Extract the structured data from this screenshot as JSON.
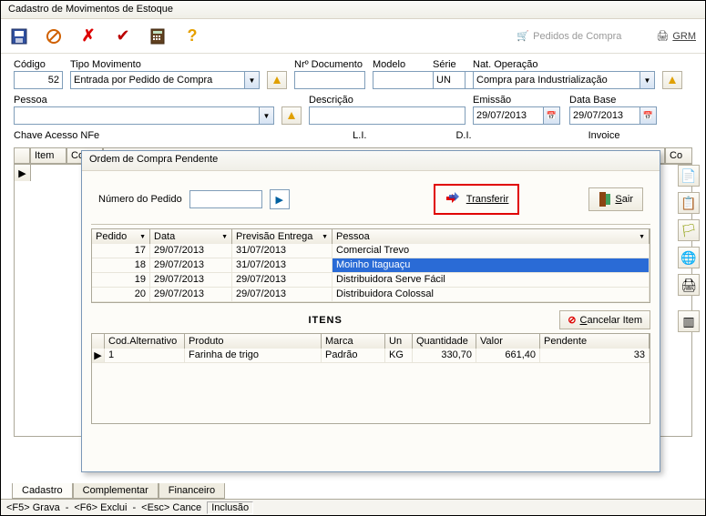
{
  "window": {
    "title": "Cadastro de Movimentos de Estoque"
  },
  "toolbar": {
    "pedidos_compra": "Pedidos de Compra",
    "grm": "GRM"
  },
  "fields": {
    "codigo_label": "Código",
    "codigo_value": "52",
    "tipo_mov_label": "Tipo Movimento",
    "tipo_mov_value": "Entrada por Pedido de Compra",
    "nr_doc_label": "Nrº Documento",
    "modelo_label": "Modelo",
    "serie_label": "Série",
    "serie_value": "UN",
    "natop_label": "Nat. Operação",
    "natop_value": "Compra para Industrialização",
    "pessoa_label": "Pessoa",
    "descricao_label": "Descrição",
    "emissao_label": "Emissão",
    "emissao_value": "29/07/2013",
    "database_label": "Data Base",
    "database_value": "29/07/2013",
    "chave_label": "Chave Acesso NFe",
    "li_label": "L.I.",
    "di_label": "D.I.",
    "invoice_label": "Invoice"
  },
  "main_grid": {
    "cols": [
      "Item",
      "Cod",
      "Co"
    ]
  },
  "tabs": {
    "cadastro": "Cadastro",
    "complementar": "Complementar",
    "financeiro": "Financeiro"
  },
  "status": {
    "grava": "<F5>  Grava",
    "exclui": "<F6>  Exclui",
    "cance": "<Esc>  Cance",
    "inclusao": "Inclusão"
  },
  "modal": {
    "title": "Ordem de Compra Pendente",
    "numero_label": "Número do Pedido",
    "transferir": "Transferir",
    "sair": "Sair",
    "itens_title": "ITENS",
    "cancelar_item": "Cancelar Item",
    "orders_cols": {
      "pedido": "Pedido",
      "data": "Data",
      "previsao": "Previsão Entrega",
      "pessoa": "Pessoa"
    },
    "orders_rows": [
      {
        "pedido": "17",
        "data": "29/07/2013",
        "previsao": "31/07/2013",
        "pessoa": "Comercial Trevo"
      },
      {
        "pedido": "18",
        "data": "29/07/2013",
        "previsao": "31/07/2013",
        "pessoa": "Moinho Itaguaçu",
        "selected": true
      },
      {
        "pedido": "19",
        "data": "29/07/2013",
        "previsao": "29/07/2013",
        "pessoa": "Distribuidora Serve Fácil"
      },
      {
        "pedido": "20",
        "data": "29/07/2013",
        "previsao": "29/07/2013",
        "pessoa": "Distribuidora Colossal"
      }
    ],
    "items_cols": {
      "codalt": "Cod.Alternativo",
      "produto": "Produto",
      "marca": "Marca",
      "un": "Un",
      "quantidade": "Quantidade",
      "valor": "Valor",
      "pendente": "Pendente"
    },
    "items_rows": [
      {
        "codalt": "1",
        "produto": "Farinha de trigo",
        "marca": "Padrão",
        "un": "KG",
        "quantidade": "330,70",
        "valor": "661,40",
        "pendente": "33"
      }
    ]
  }
}
